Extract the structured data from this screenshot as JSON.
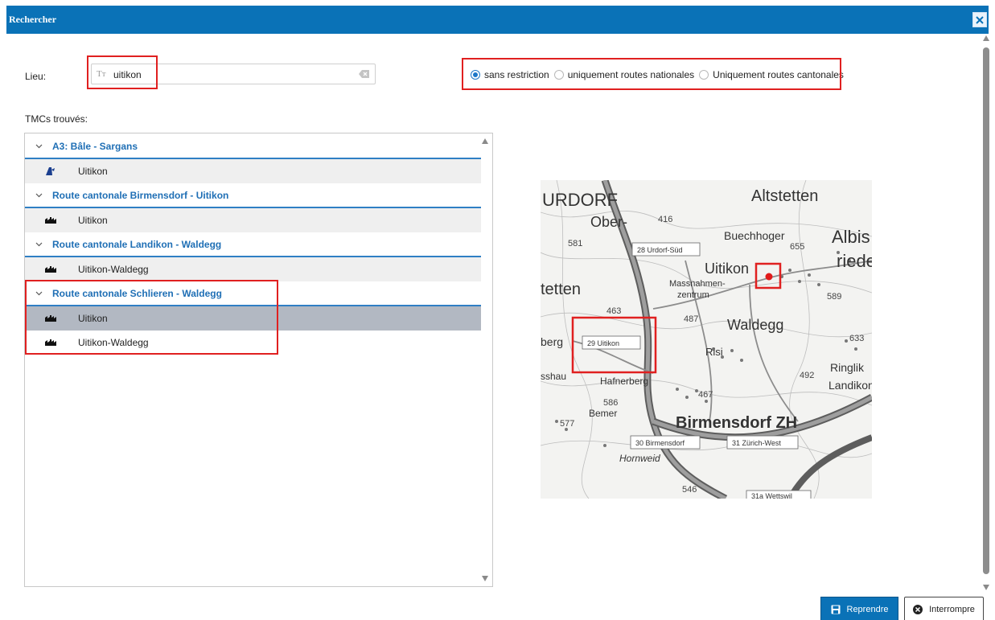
{
  "dialog": {
    "title": "Rechercher"
  },
  "search": {
    "label": "Lieu:",
    "type_glyph": "Tт",
    "value": "uitikon"
  },
  "filters": [
    {
      "label": "sans restriction",
      "selected": true
    },
    {
      "label": "uniquement routes nationales",
      "selected": false
    },
    {
      "label": "Uniquement routes cantonales",
      "selected": false
    }
  ],
  "results": {
    "label": "TMCs trouvés:",
    "groups": [
      {
        "label": "A3: Bâle - Sargans",
        "items": [
          {
            "label": "Uitikon",
            "icon": "motorway-junction-icon"
          }
        ]
      },
      {
        "label": "Route cantonale Birmensdorf - Uitikon",
        "items": [
          {
            "label": "Uitikon",
            "icon": "town-icon"
          }
        ]
      },
      {
        "label": "Route cantonale Landikon - Waldegg",
        "items": [
          {
            "label": "Uitikon-Waldegg",
            "icon": "town-icon"
          }
        ]
      },
      {
        "label": "Route cantonale Schlieren - Waldegg",
        "items": [
          {
            "label": "Uitikon",
            "icon": "town-icon",
            "selected": true
          },
          {
            "label": "Uitikon-Waldegg",
            "icon": "town-icon"
          }
        ]
      }
    ]
  },
  "map": {
    "places": [
      "URDORF",
      "Altstetten",
      "Ober-",
      "Buechhoger",
      "Albis",
      "riede",
      "Uitikon",
      "tetten",
      "Massnahmen-",
      "zentrum",
      "Waldegg",
      "Risi",
      "berg",
      "Ringlik",
      "Landikon",
      "Hafnerberg",
      "Bemer",
      "Birmensdorf ZH",
      "Hornweid",
      "sshau"
    ],
    "heights": [
      "416",
      "581",
      "655",
      "589",
      "463",
      "487",
      "633",
      "492",
      "467",
      "586",
      "577",
      "546"
    ],
    "exits": [
      "28 Urdorf-Süd",
      "29 Uitikon",
      "30 Birmensdorf",
      "31 Zürich-West",
      "31a Wettswil"
    ],
    "marker_color": "#e11a1a"
  },
  "buttons": {
    "confirm": "Reprendre",
    "cancel": "Interrompre"
  },
  "colors": {
    "accent": "#0a72b7",
    "group_text": "#1f6fb5",
    "highlight": "#e02020",
    "selected_row": "#b2b8c2"
  }
}
